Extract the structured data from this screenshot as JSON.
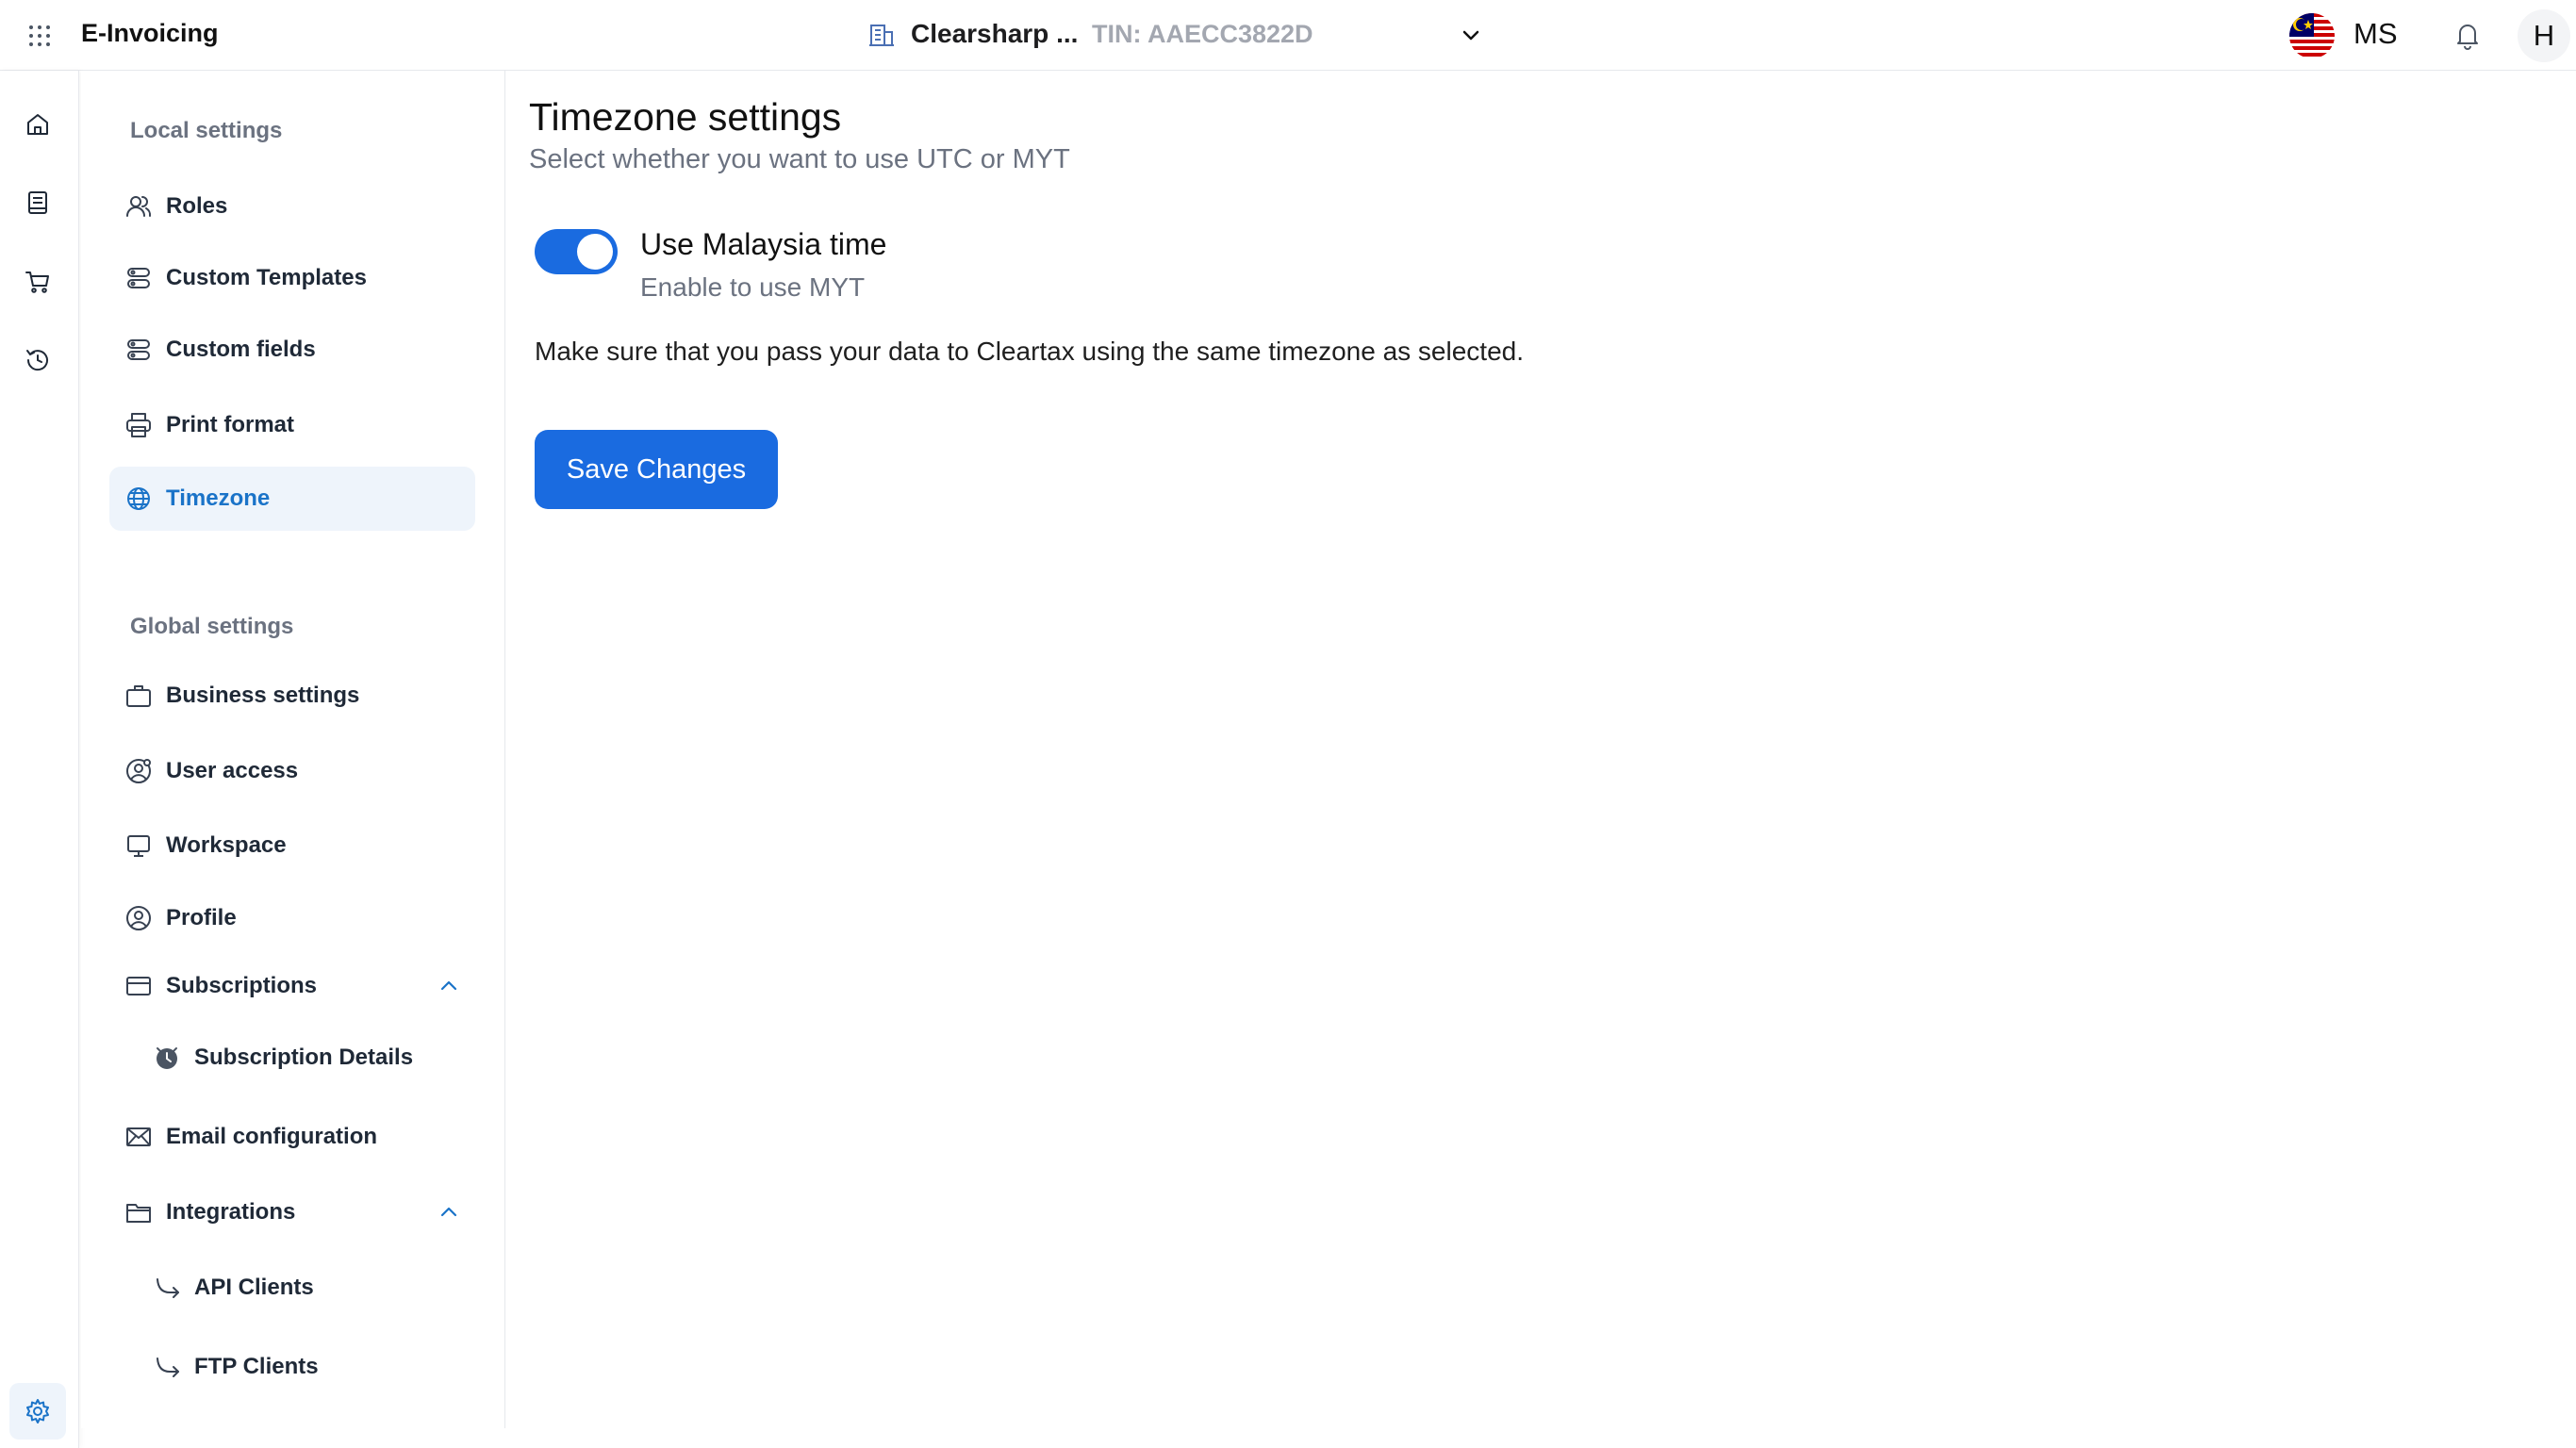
{
  "header": {
    "app_title": "E-Invoicing",
    "org_name": "Clearsharp ...",
    "org_tin": "TIN: AAECC3822D",
    "country_code": "MS",
    "avatar_initial": "H",
    "icons": [
      "apps-grid-icon",
      "building-icon",
      "chevron-down-icon",
      "malaysia-flag-icon",
      "bell-icon"
    ]
  },
  "rail": {
    "icons": [
      "home-icon",
      "book-icon",
      "cart-icon",
      "history-icon",
      "gear-icon"
    ]
  },
  "settings_nav": {
    "local_heading": "Local settings",
    "local_items": [
      {
        "label": "Roles",
        "icon": "users-icon"
      },
      {
        "label": "Custom Templates",
        "icon": "template-icon"
      },
      {
        "label": "Custom fields",
        "icon": "fields-icon"
      },
      {
        "label": "Print format",
        "icon": "printer-icon"
      },
      {
        "label": "Timezone",
        "icon": "globe-icon",
        "active": true
      }
    ],
    "global_heading": "Global settings",
    "global_items": [
      {
        "label": "Business settings",
        "icon": "briefcase-icon"
      },
      {
        "label": "User access",
        "icon": "user-access-icon"
      },
      {
        "label": "Workspace",
        "icon": "monitor-icon"
      },
      {
        "label": "Profile",
        "icon": "profile-icon"
      },
      {
        "label": "Subscriptions",
        "icon": "card-icon",
        "expanded": true
      },
      {
        "label": "Subscription Details",
        "icon": "clock-icon",
        "sub": true
      },
      {
        "label": "Email configuration",
        "icon": "mail-icon"
      },
      {
        "label": "Integrations",
        "icon": "folder-icon",
        "expanded": true
      },
      {
        "label": "API Clients",
        "icon": "arrow-return-icon",
        "sub": true
      },
      {
        "label": "FTP Clients",
        "icon": "arrow-return-icon",
        "sub": true
      }
    ]
  },
  "main": {
    "title": "Timezone settings",
    "subtitle": "Select whether you want to use UTC or MYT",
    "toggle": {
      "title": "Use Malaysia time",
      "description": "Enable to use MYT",
      "enabled": true
    },
    "notice": "Make sure that you pass your data to Cleartax using the same timezone as selected.",
    "save_label": "Save Changes"
  },
  "colors": {
    "accent": "#1a6be0",
    "active_bg": "#eef4fb",
    "active_text": "#1a73c8",
    "muted_text": "#6b7280",
    "tin_text": "#a3a7b0"
  }
}
